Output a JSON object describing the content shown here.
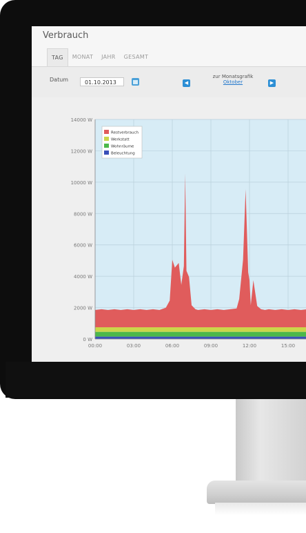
{
  "page": {
    "title": "Verbrauch"
  },
  "tabs": [
    {
      "label": "TAG",
      "active": true
    },
    {
      "label": "MONAT",
      "active": false
    },
    {
      "label": "JAHR",
      "active": false
    },
    {
      "label": "GESAMT",
      "active": false
    }
  ],
  "toolbar": {
    "date_label": "Datum",
    "date_value": "01.10.2013",
    "calendar_icon": "calendar-icon",
    "prev_icon": "chevron-left-icon",
    "next_icon": "chevron-right-icon",
    "month_nav_text": "zur Monatsgrafik",
    "month_link": "Oktober"
  },
  "colors": {
    "series_rest": "#e05c5c",
    "series_werkstatt": "#cbd64a",
    "series_wohnraeume": "#4cb84a",
    "series_beleuchtung": "#3a4fb8",
    "plot_background": "#d7ecf6",
    "nav_button": "#2d8fd5"
  },
  "chart_data": {
    "type": "area",
    "stacked": true,
    "ylim": [
      0,
      14000
    ],
    "yticks": [
      "0 W",
      "2000 W",
      "4000 W",
      "6000 W",
      "8000 W",
      "10000 W",
      "12000 W",
      "14000 W"
    ],
    "xticks": [
      "00:00",
      "03:00",
      "06:00",
      "09:00",
      "12:00",
      "15:00"
    ],
    "grid": true,
    "legend_position": "top-left",
    "x": [
      0,
      0.5,
      1,
      1.5,
      2,
      2.5,
      3,
      3.5,
      4,
      4.5,
      5,
      5.5,
      5.8,
      6,
      6.2,
      6.5,
      6.7,
      6.9,
      7,
      7.1,
      7.3,
      7.5,
      7.8,
      8,
      8.5,
      9,
      9.5,
      10,
      10.5,
      11,
      11.2,
      11.5,
      11.7,
      11.9,
      12,
      12.1,
      12.3,
      12.6,
      12.9,
      13.2,
      13.5,
      14,
      14.5,
      15,
      15.5,
      16,
      16.5
    ],
    "series": [
      {
        "name": "Beleuchtung",
        "values": [
          150,
          150,
          150,
          150,
          150,
          150,
          150,
          150,
          150,
          150,
          150,
          150,
          150,
          150,
          150,
          150,
          150,
          150,
          150,
          150,
          150,
          150,
          150,
          150,
          150,
          150,
          150,
          150,
          150,
          150,
          150,
          150,
          150,
          150,
          150,
          150,
          150,
          150,
          150,
          150,
          150,
          150,
          150,
          150,
          150,
          150,
          150
        ]
      },
      {
        "name": "Wohnräume",
        "values": [
          300,
          300,
          300,
          300,
          300,
          300,
          300,
          300,
          300,
          300,
          300,
          300,
          300,
          300,
          300,
          300,
          300,
          300,
          300,
          300,
          300,
          300,
          300,
          300,
          300,
          300,
          300,
          300,
          300,
          300,
          300,
          300,
          300,
          300,
          300,
          300,
          300,
          300,
          300,
          300,
          300,
          300,
          300,
          300,
          300,
          300,
          300
        ]
      },
      {
        "name": "Werkstatt",
        "values": [
          300,
          300,
          300,
          300,
          300,
          300,
          300,
          300,
          300,
          300,
          300,
          300,
          300,
          300,
          300,
          300,
          300,
          300,
          300,
          300,
          300,
          300,
          300,
          300,
          300,
          300,
          300,
          300,
          300,
          300,
          300,
          300,
          300,
          300,
          300,
          300,
          300,
          300,
          300,
          300,
          300,
          300,
          300,
          300,
          300,
          300,
          300
        ]
      },
      {
        "name": "Restverbrauch",
        "values": [
          1100,
          1150,
          1100,
          1150,
          1100,
          1150,
          1100,
          1150,
          1100,
          1150,
          1100,
          1250,
          1700,
          4300,
          3800,
          4100,
          2700,
          3900,
          9800,
          3600,
          3200,
          1400,
          1150,
          1100,
          1150,
          1100,
          1150,
          1100,
          1150,
          1200,
          1800,
          4300,
          8800,
          3500,
          3000,
          1400,
          3000,
          1350,
          1150,
          1100,
          1150,
          1100,
          1150,
          1100,
          1150,
          1100,
          1150
        ]
      }
    ]
  }
}
